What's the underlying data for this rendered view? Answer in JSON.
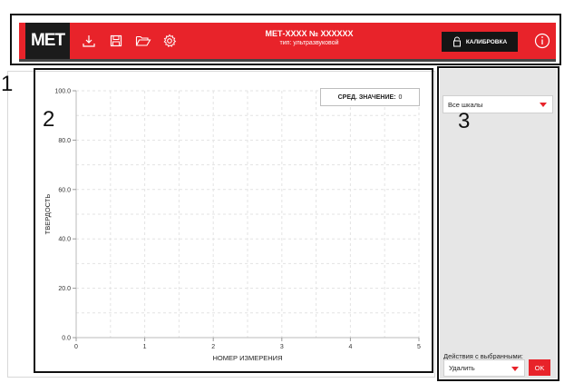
{
  "header": {
    "logo": "МЕТ",
    "title": "МЕТ-XXXX № XXXXXX",
    "subtitle": "тип: ультразвуковой",
    "calibration_label": "КАЛИБРОВКА",
    "icons": [
      "download-icon",
      "save-icon",
      "folder-open-icon",
      "gear-icon",
      "info-icon",
      "lock-icon"
    ],
    "accent_color": "#e8232a"
  },
  "annotations": {
    "header": "1",
    "chart": "2",
    "sidebar": "3"
  },
  "average": {
    "label": "СРЕД. ЗНАЧЕНИЕ:",
    "value": "0"
  },
  "sidebar": {
    "scale_select": "Все шкалы",
    "actions_label": "Действия с выбранными:",
    "action_select": "Удалить",
    "ok_label": "OK"
  },
  "chart_data": {
    "type": "line",
    "xlabel": "НОМЕР ИЗМЕРЕНИЯ",
    "ylabel": "ТВЕРДОСТЬ",
    "xlim": [
      0,
      5
    ],
    "ylim": [
      0,
      100
    ],
    "x_ticks": [
      "0",
      "1",
      "2",
      "3",
      "4",
      "5"
    ],
    "y_ticks": [
      "0.0",
      "20.0",
      "40.0",
      "60.0",
      "80.0",
      "100.0"
    ],
    "grid": true,
    "series": []
  }
}
